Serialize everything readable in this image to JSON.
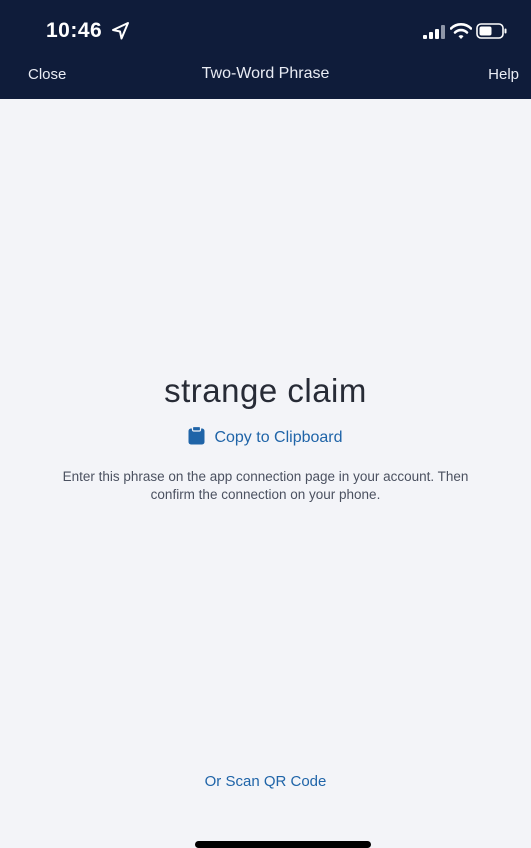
{
  "status_bar": {
    "time": "10:46",
    "icons": [
      "location-arrow-icon",
      "cellular-signal-icon",
      "wifi-icon",
      "battery-icon"
    ]
  },
  "nav": {
    "close_label": "Close",
    "title": "Two-Word Phrase",
    "help_label": "Help"
  },
  "main": {
    "phrase": "strange claim",
    "copy_label": "Copy to Clipboard",
    "copy_icon": "clipboard-icon",
    "instructions": "Enter this phrase on the app connection page in your account. Then confirm the connection on your phone.",
    "scan_qr_label": "Or Scan QR Code"
  },
  "colors": {
    "header_bg": "#0f1c3a",
    "page_bg": "#f3f4f8",
    "link": "#1f64a8",
    "phrase_text": "#272b36"
  }
}
